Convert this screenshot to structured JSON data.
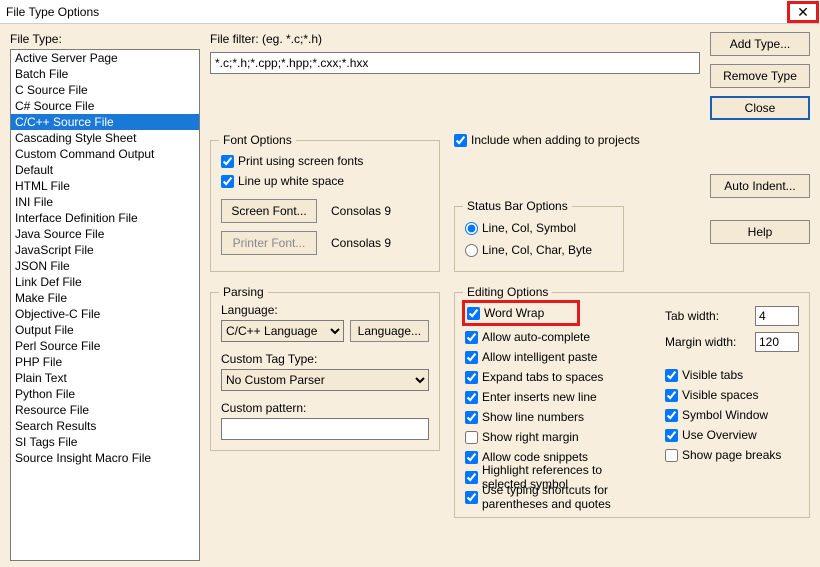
{
  "title": "File Type Options",
  "leftLabel": "File Type:",
  "filterLabel": "File filter: (eg. *.c;*.h)",
  "filterValue": "*.c;*.h;*.cpp;*.hpp;*.cxx;*.hxx",
  "btns": {
    "add": "Add Type...",
    "remove": "Remove Type",
    "close": "Close",
    "autoindent": "Auto Indent...",
    "help": "Help",
    "screenfont": "Screen Font...",
    "printerfont": "Printer Font...",
    "lang": "Language..."
  },
  "fileTypes": [
    "Active Server Page",
    "Batch File",
    "C Source File",
    "C# Source File",
    "C/C++ Source File",
    "Cascading Style Sheet",
    "Custom Command Output",
    "Default",
    "HTML File",
    "INI File",
    "Interface Definition File",
    "Java Source File",
    "JavaScript File",
    "JSON File",
    "Link Def File",
    "Make File",
    "Objective-C File",
    "Output File",
    "Perl Source File",
    "PHP File",
    "Plain Text",
    "Python File",
    "Resource File",
    "Search Results",
    "SI Tags File",
    "Source Insight Macro File"
  ],
  "selectedIndex": 4,
  "fontOptions": {
    "title": "Font Options",
    "print": "Print using screen fonts",
    "lineup": "Line up white space",
    "consolas": "Consolas 9"
  },
  "includeProjects": "Include when adding to projects",
  "statusBar": {
    "title": "Status Bar Options",
    "opt1": "Line, Col, Symbol",
    "opt2": "Line, Col, Char, Byte"
  },
  "parsing": {
    "title": "Parsing",
    "langLabel": "Language:",
    "langValue": "C/C++ Language",
    "customTag": "Custom Tag Type:",
    "customTagValue": "No Custom Parser",
    "customPattern": "Custom pattern:"
  },
  "editing": {
    "title": "Editing Options",
    "wordwrap": "Word Wrap",
    "autocomplete": "Allow auto-complete",
    "intellipaste": "Allow intelligent paste",
    "expandtabs": "Expand tabs to spaces",
    "enterinserts": "Enter inserts new line",
    "linenumbers": "Show line numbers",
    "rightmargin": "Show right margin",
    "codesnippets": "Allow code snippets",
    "highlight": "Highlight references to selected symbol",
    "typing": "Use typing shortcuts for parentheses and quotes",
    "tabwidth": "Tab width:",
    "tabwidthval": "4",
    "marginwidth": "Margin width:",
    "marginwidthval": "120",
    "visibletabs": "Visible tabs",
    "visiblespaces": "Visible spaces",
    "symbolwin": "Symbol Window",
    "useoverview": "Use Overview",
    "pagebreaks": "Show page breaks"
  }
}
